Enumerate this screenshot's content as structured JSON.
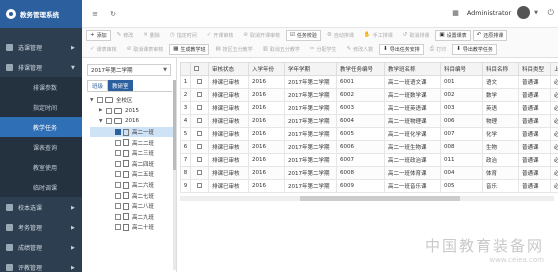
{
  "app": {
    "title": "教务管理系统"
  },
  "sidebar": {
    "items": [
      {
        "label": "选课管理",
        "icon": "course-icon"
      },
      {
        "label": "排课管理",
        "icon": "schedule-icon",
        "open": true
      }
    ],
    "sub_items": [
      {
        "label": "排课参数",
        "active": false
      },
      {
        "label": "指定时间",
        "active": false
      },
      {
        "label": "教学任务",
        "active": true
      },
      {
        "label": "课表查询",
        "active": false
      },
      {
        "label": "教室使用",
        "active": false
      },
      {
        "label": "临时调课",
        "active": false
      }
    ],
    "bottom_items": [
      {
        "label": "校本选课",
        "icon": "book-icon"
      },
      {
        "label": "考务管理",
        "icon": "exam-icon"
      },
      {
        "label": "成绩管理",
        "icon": "grade-icon"
      },
      {
        "label": "评教管理",
        "icon": "evaluate-icon"
      }
    ]
  },
  "topbar": {
    "username": "Administrator"
  },
  "toolbar": {
    "row1": [
      {
        "label": "添加",
        "icon": "+",
        "enabled": true
      },
      {
        "label": "修改",
        "icon": "✎",
        "enabled": false
      },
      {
        "label": "删除",
        "icon": "✕",
        "enabled": false
      },
      {
        "label": "指定时间",
        "icon": "◷",
        "enabled": false
      },
      {
        "label": "开课审核",
        "icon": "✓",
        "enabled": false
      },
      {
        "label": "取消开课审核",
        "icon": "⊘",
        "enabled": false
      },
      {
        "label": "任务校验",
        "icon": "☑",
        "enabled": true
      },
      {
        "label": "自动排课",
        "icon": "⚙",
        "enabled": false
      },
      {
        "label": "手工排课",
        "icon": "✋",
        "enabled": false
      },
      {
        "label": "取消排课",
        "icon": "↺",
        "enabled": false
      },
      {
        "label": "设置课表",
        "icon": "▣",
        "enabled": true
      },
      {
        "label": "还原排课",
        "icon": "↶",
        "enabled": true
      }
    ],
    "row2": [
      {
        "label": "课表审核",
        "icon": "✓",
        "enabled": false
      },
      {
        "label": "取消课表审核",
        "icon": "⊘",
        "enabled": false
      },
      {
        "label": "生成教学班",
        "icon": "▦",
        "enabled": true
      },
      {
        "label": "按区五分教学",
        "icon": "▤",
        "enabled": false
      },
      {
        "label": "取消五分教学",
        "icon": "▥",
        "enabled": false
      },
      {
        "label": "分配学生",
        "icon": "✂",
        "enabled": false
      },
      {
        "label": "修改人数",
        "icon": "✎",
        "enabled": false
      },
      {
        "label": "导出任务安排",
        "icon": "⬇",
        "enabled": true
      },
      {
        "label": "打印",
        "icon": "⎙",
        "enabled": false
      },
      {
        "label": "导出教学任务",
        "icon": "⬇",
        "enabled": true
      }
    ]
  },
  "tree_panel": {
    "term": "2017年第二学期",
    "tabs": [
      "班级",
      "教研室"
    ],
    "nodes": [
      {
        "label": "全校区",
        "level": 0,
        "arrow": "▼",
        "type": "folder"
      },
      {
        "label": "2015",
        "level": 1,
        "arrow": "▶",
        "type": "folder"
      },
      {
        "label": "2016",
        "level": 1,
        "arrow": "▼",
        "type": "folder"
      },
      {
        "label": "高二一班",
        "level": 2,
        "arrow": "",
        "type": "doc",
        "checked": true,
        "selected": true
      },
      {
        "label": "高二二班",
        "level": 2,
        "arrow": "",
        "type": "doc"
      },
      {
        "label": "高二三班",
        "level": 2,
        "arrow": "",
        "type": "doc"
      },
      {
        "label": "高二四班",
        "level": 2,
        "arrow": "",
        "type": "doc"
      },
      {
        "label": "高二五班",
        "level": 2,
        "arrow": "",
        "type": "doc"
      },
      {
        "label": "高二六班",
        "level": 2,
        "arrow": "",
        "type": "doc"
      },
      {
        "label": "高二七班",
        "level": 2,
        "arrow": "",
        "type": "doc"
      },
      {
        "label": "高二八班",
        "level": 2,
        "arrow": "",
        "type": "doc"
      },
      {
        "label": "高二九班",
        "level": 2,
        "arrow": "",
        "type": "doc"
      },
      {
        "label": "高二十班",
        "level": 2,
        "arrow": "",
        "type": "doc"
      }
    ]
  },
  "table": {
    "columns": [
      "",
      "",
      "审核状态",
      "入学年份",
      "学年学期",
      "教学任务编号",
      "教学班名称",
      "科目编号",
      "科目名称",
      "科目类型",
      "上"
    ],
    "rows": [
      [
        "1",
        "排课已审核",
        "2016",
        "2017年第二学期",
        "6001",
        "高二一班语文课",
        "001",
        "语文",
        "普通课",
        "必"
      ],
      [
        "2",
        "排课已审核",
        "2016",
        "2017年第二学期",
        "6002",
        "高二一班数学课",
        "002",
        "数学",
        "普通课",
        "必"
      ],
      [
        "3",
        "排课已审核",
        "2016",
        "2017年第二学期",
        "6003",
        "高二一班英语课",
        "003",
        "英语",
        "普通课",
        "必"
      ],
      [
        "4",
        "排课已审核",
        "2016",
        "2017年第二学期",
        "6004",
        "高二一班物理课",
        "006",
        "物理",
        "普通课",
        "必"
      ],
      [
        "5",
        "排课已审核",
        "2016",
        "2017年第二学期",
        "6005",
        "高二一班化学课",
        "007",
        "化学",
        "普通课",
        "必"
      ],
      [
        "6",
        "排课已审核",
        "2016",
        "2017年第二学期",
        "6006",
        "高二一班生物课",
        "008",
        "生物",
        "普通课",
        "必"
      ],
      [
        "7",
        "排课已审核",
        "2016",
        "2017年第二学期",
        "6007",
        "高二一班政治课",
        "011",
        "政治",
        "普通课",
        "必"
      ],
      [
        "8",
        "排课已审核",
        "2016",
        "2017年第二学期",
        "6008",
        "高二一班体育课",
        "004",
        "体育",
        "普通课",
        "必"
      ],
      [
        "9",
        "排课已审核",
        "2016",
        "2017年第二学期",
        "6009",
        "高二一班音乐课",
        "005",
        "音乐",
        "普通课",
        "必"
      ]
    ]
  },
  "watermark": {
    "line1": "中国教育装备网",
    "line2": "www.ceiea.com"
  }
}
